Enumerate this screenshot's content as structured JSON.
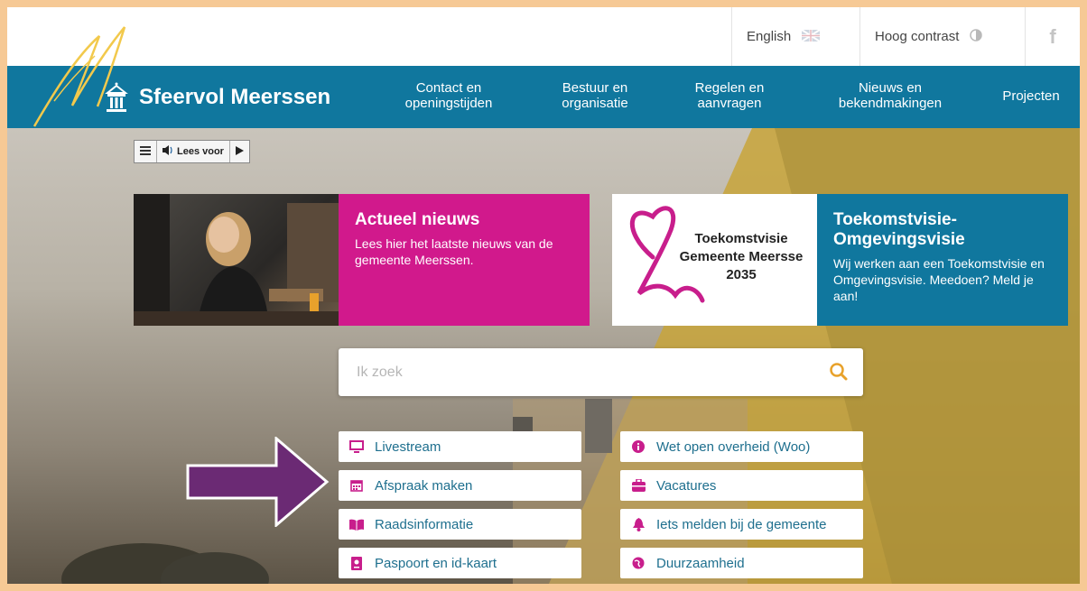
{
  "utility": {
    "language": "English",
    "contrast": "Hoog contrast"
  },
  "brand": {
    "name": "Sfeervol Meerssen"
  },
  "nav": [
    {
      "line1": "Contact en",
      "line2": "openingstijden"
    },
    {
      "line1": "Bestuur en",
      "line2": "organisatie"
    },
    {
      "line1": "Regelen en",
      "line2": "aanvragen"
    },
    {
      "line1": "Nieuws en",
      "line2": "bekendmakingen"
    },
    {
      "line1": "Projecten",
      "line2": ""
    }
  ],
  "readspeaker": {
    "label": "Lees voor"
  },
  "cards": [
    {
      "title": "Actueel nieuws",
      "text": "Lees hier het laatste nieuws van de gemeente Meerssen.",
      "color": "#d1198c"
    },
    {
      "title": "Toekomstvisie-Omgevingsvisie",
      "text": "Wij werken aan een Toekomstvisie en Omgevingsvisie. Meedoen? Meld je aan!",
      "color": "#10779e",
      "logo_lines": [
        "Toekomstvisie",
        "Gemeente Meersse",
        "2035"
      ]
    }
  ],
  "search": {
    "placeholder": "Ik zoek",
    "value": ""
  },
  "quicklinks_left": [
    {
      "label": "Livestream",
      "icon": "monitor-icon"
    },
    {
      "label": "Afspraak maken",
      "icon": "calendar-icon"
    },
    {
      "label": "Raadsinformatie",
      "icon": "book-icon"
    },
    {
      "label": "Paspoort en id-kaart",
      "icon": "passport-icon"
    }
  ],
  "quicklinks_right": [
    {
      "label": "Wet open overheid (Woo)",
      "icon": "info-icon"
    },
    {
      "label": "Vacatures",
      "icon": "briefcase-icon"
    },
    {
      "label": "Iets melden bij de gemeente",
      "icon": "bell-icon"
    },
    {
      "label": "Duurzaamheid",
      "icon": "leaf-globe-icon"
    }
  ],
  "colors": {
    "accent_blue": "#10779e",
    "accent_magenta": "#d1198c",
    "arrow_purple": "#6b2a74"
  }
}
